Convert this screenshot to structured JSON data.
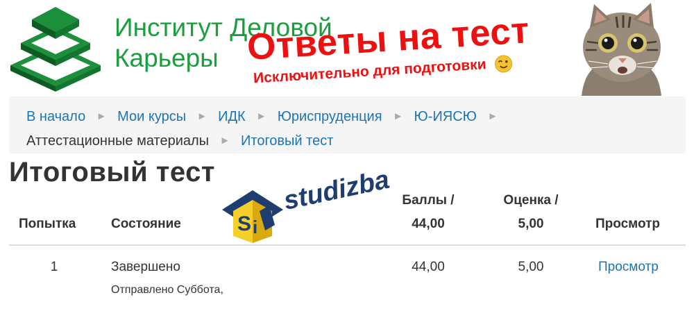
{
  "header": {
    "institute_line1": "Институт Деловой",
    "institute_line2": "Карьеры",
    "answers_banner": "Ответы на тест",
    "tagline": "Исключительно для подготовки",
    "colors": {
      "institute_green": "#1b9e3e",
      "banner_red": "#ee1010"
    },
    "icons": {
      "logo": "stacked-pyramid-logo-icon",
      "emoji": "winking-smiley-icon",
      "cat": "surprised-cat-image"
    }
  },
  "breadcrumb": {
    "items": [
      {
        "label": "В начало",
        "link": true
      },
      {
        "label": "Мои курсы",
        "link": true
      },
      {
        "label": "ИДК",
        "link": true
      },
      {
        "label": "Юриспруденция",
        "link": true
      },
      {
        "label": "Ю-ИЯСЮ",
        "link": true
      },
      {
        "label": "Аттестационные материалы",
        "link": false
      },
      {
        "label": "Итоговый тест",
        "link": true
      }
    ],
    "separator": "►"
  },
  "page": {
    "title": "Итоговый тест"
  },
  "watermark": {
    "text": "studizba"
  },
  "table": {
    "headers": {
      "attempt": "Попытка",
      "state": "Состояние",
      "score_line1": "Баллы /",
      "score_line2": "44,00",
      "grade_line1": "Оценка /",
      "grade_line2": "5,00",
      "review": "Просмотр"
    },
    "rows": [
      {
        "attempt": "1",
        "state": "Завершено",
        "submitted": "Отправлено Суббота,",
        "score": "44,00",
        "grade": "5,00",
        "review": "Просмотр"
      }
    ]
  }
}
